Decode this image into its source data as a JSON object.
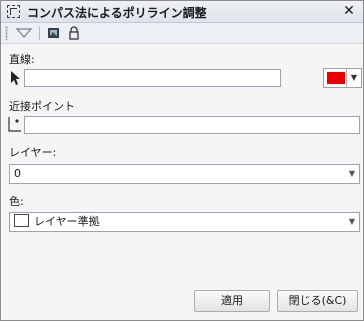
{
  "window": {
    "title": "コンパス法によるポリライン調整",
    "close_glyph": "✕"
  },
  "toolbar": {
    "icons": [
      "filter-icon",
      "image-icon",
      "lock-icon"
    ]
  },
  "line_field": {
    "label": "直線:",
    "value": "",
    "icon": "pointer-icon",
    "color": "#ee0000"
  },
  "near_point": {
    "label": "近接ポイント",
    "value": "",
    "icon": "snap-point-icon"
  },
  "layer": {
    "label": "レイヤー:",
    "value": "0"
  },
  "color": {
    "label": "色:",
    "value": "レイヤー準拠"
  },
  "buttons": {
    "apply": "適用",
    "close": "閉じる(&C)"
  }
}
